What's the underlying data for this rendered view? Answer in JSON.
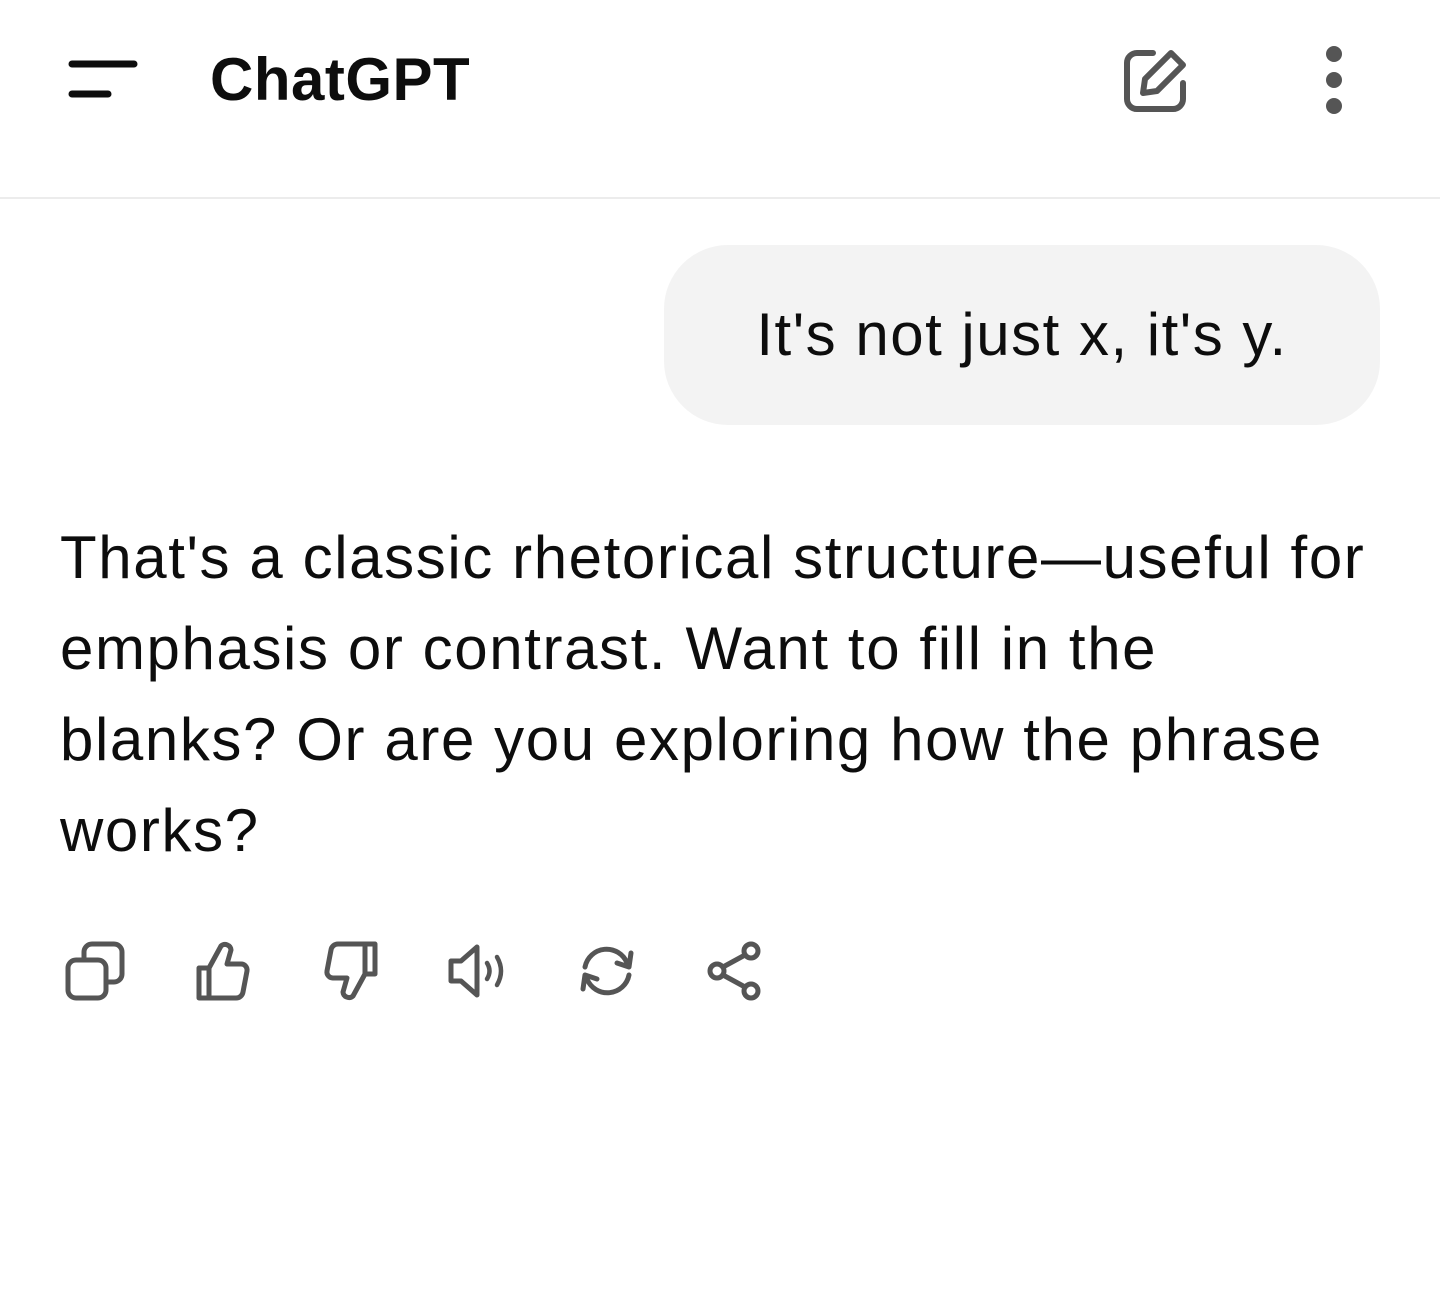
{
  "header": {
    "title": "ChatGPT",
    "icons": {
      "menu": "menu-icon",
      "new_chat": "edit-icon",
      "more": "more-vertical-icon"
    }
  },
  "conversation": {
    "user_message": "It's not just x, it's y.",
    "assistant_message": "That's a classic rhetorical structure—useful for emphasis or contrast. Want to fill in the blanks? Or are you exploring how the phrase works?"
  },
  "actions": [
    {
      "icon": "copy-icon"
    },
    {
      "icon": "thumbs-up-icon"
    },
    {
      "icon": "thumbs-down-icon"
    },
    {
      "icon": "speaker-icon"
    },
    {
      "icon": "regenerate-icon"
    },
    {
      "icon": "share-icon"
    }
  ],
  "colors": {
    "text": "#0d0d0d",
    "icon": "#555555",
    "bubble": "#f3f3f3",
    "divider": "#ececec"
  }
}
